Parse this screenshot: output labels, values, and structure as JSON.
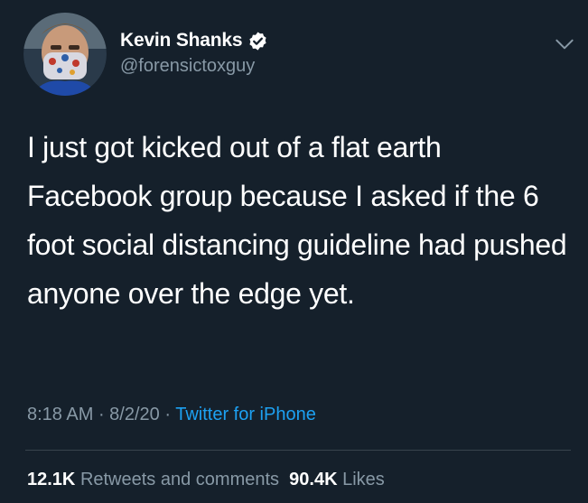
{
  "author": {
    "display_name": "Kevin Shanks",
    "handle": "@forensictoxguy",
    "verified_icon": "verified-badge-icon",
    "avatar_icon": "avatar-photo"
  },
  "tweet": {
    "text": "I just got kicked out of a flat earth Facebook group because I asked if the 6 foot social distancing guideline had pushed anyone over the edge yet."
  },
  "meta": {
    "time": "8:18 AM",
    "sep1": " · ",
    "date": "8/2/20",
    "sep2": " · ",
    "source": "Twitter for iPhone"
  },
  "stats": {
    "retweets_count": "12.1K",
    "retweets_label": "Retweets and comments",
    "likes_count": "90.4K",
    "likes_label": "Likes"
  },
  "colors": {
    "background": "#15202b",
    "secondary_text": "#8899a6",
    "link": "#1da1f2",
    "divider": "#38444d"
  }
}
